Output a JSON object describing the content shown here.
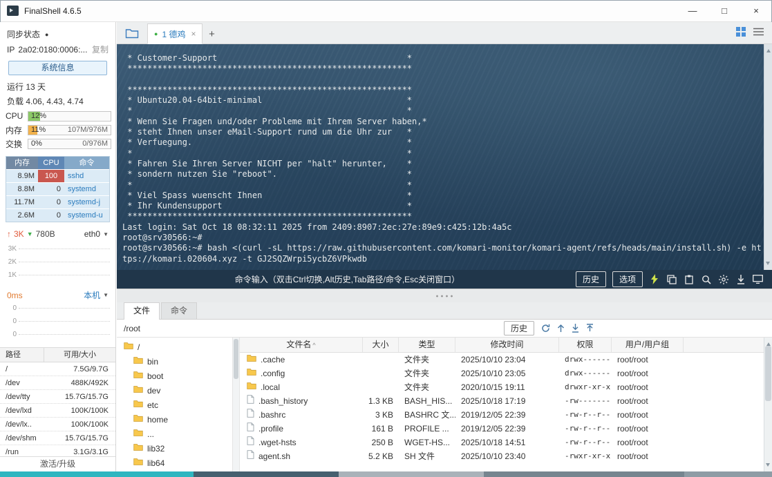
{
  "window": {
    "title": "FinalShell 4.6.5",
    "minimize": "—",
    "maximize": "□",
    "close": "×"
  },
  "sidebar": {
    "sync_label": "同步状态",
    "sync_dot": "●",
    "ip_label": "IP",
    "ip_value": "2a02:0180:0006:...",
    "copy_link": "复制",
    "sysinfo_button": "系统信息",
    "uptime": "运行 13 天",
    "load": "负载 4.06, 4.43, 4.74",
    "meters": {
      "cpu_label": "CPU",
      "cpu_percent": "12%",
      "mem_label": "内存",
      "mem_percent": "11%",
      "mem_detail": "107M/976M",
      "swap_label": "交换",
      "swap_percent": "0%",
      "swap_detail": "0/976M"
    },
    "process_table": {
      "col_mem": "内存",
      "col_cpu": "CPU",
      "col_cmd": "命令",
      "rows": [
        {
          "mem": "8.9M",
          "cpu": "100",
          "cmd": "sshd"
        },
        {
          "mem": "8.8M",
          "cpu": "0",
          "cmd": "systemd"
        },
        {
          "mem": "11.7M",
          "cpu": "0",
          "cmd": "systemd-j"
        },
        {
          "mem": "2.6M",
          "cpu": "0",
          "cmd": "systemd-u"
        }
      ]
    },
    "network": {
      "up_arrow": "↑",
      "up_value": "3K",
      "down_arrow": "▼",
      "down_value": "780B",
      "interface": "eth0",
      "caret": "▼",
      "y_labels": [
        "3K",
        "2K",
        "1K"
      ]
    },
    "ping": {
      "latency": "0ms",
      "target": "本机",
      "caret": "▼",
      "y_labels": [
        "0",
        "0",
        "0"
      ]
    },
    "disk_table": {
      "col_path": "路径",
      "col_size": "可用/大小",
      "rows": [
        {
          "path": "/",
          "size": "7.5G/9.7G"
        },
        {
          "path": "/dev",
          "size": "488K/492K"
        },
        {
          "path": "/dev/tty",
          "size": "15.7G/15.7G"
        },
        {
          "path": "/dev/lxd",
          "size": "100K/100K"
        },
        {
          "path": "/dev/lx..",
          "size": "100K/100K"
        },
        {
          "path": "/dev/shm",
          "size": "15.7G/15.7G"
        },
        {
          "path": "/run",
          "size": "3.1G/3.1G"
        }
      ]
    },
    "activate_label": "激活/升级"
  },
  "tabbar": {
    "session_tab": {
      "dot": "●",
      "label": "1 德鸡",
      "close": "×"
    },
    "new_tab": "+"
  },
  "terminal": {
    "lines": [
      " * Customer-Support                                      *",
      " *********************************************************",
      "",
      " *********************************************************",
      " * Ubuntu20.04-64bit-minimal                             *",
      " *                                                       *",
      " * Wenn Sie Fragen und/oder Probleme mit Ihrem Server haben,*",
      " * steht Ihnen unser eMail-Support rund um die Uhr zur   *",
      " * Verfuegung.                                           *",
      " *                                                       *",
      " * Fahren Sie Ihren Server NICHT per \"halt\" herunter,    *",
      " * sondern nutzen Sie \"reboot\".                          *",
      " *                                                       *",
      " * Viel Spass wuenscht Ihnen                             *",
      " * Ihr Kundensupport                                     *",
      " *********************************************************",
      "Last login: Sat Oct 18 08:32:11 2025 from 2409:8907:2ec:27e:89e9:c425:12b:4a5c",
      "root@srv30566:~# ",
      "root@srv30566:~# bash <(curl -sL https://raw.githubusercontent.com/komari-monitor/komari-agent/refs/heads/main/install.sh) -e ht",
      "tps://komari.020604.xyz -t GJ2SQZWrpi5ycbZ6VPkwdb"
    ]
  },
  "cmdbar": {
    "hint": "命令输入（双击Ctrl切换,Alt历史,Tab路径/命令,Esc关闭窗口）",
    "history_button": "历史",
    "options_button": "选项"
  },
  "filepanel": {
    "tab_files": "文件",
    "tab_commands": "命令",
    "path": "/root",
    "history_button": "历史",
    "tree": {
      "root": "/",
      "items": [
        "bin",
        "boot",
        "dev",
        "etc",
        "home",
        "...",
        "lib32",
        "lib64"
      ]
    },
    "table": {
      "col_name": "文件名",
      "sort_caret": "^",
      "col_size": "大小",
      "col_type": "类型",
      "col_mtime": "修改时间",
      "col_perm": "权限",
      "col_owner": "用户/用户组",
      "rows": [
        {
          "icon": "folder-icon",
          "name": ".cache",
          "size": "",
          "type": "文件夹",
          "mtime": "2025/10/10 23:04",
          "perm": "drwx------",
          "owner": "root/root"
        },
        {
          "icon": "folder-icon",
          "name": ".config",
          "size": "",
          "type": "文件夹",
          "mtime": "2025/10/10 23:05",
          "perm": "drwx------",
          "owner": "root/root"
        },
        {
          "icon": "folder-icon",
          "name": ".local",
          "size": "",
          "type": "文件夹",
          "mtime": "2020/10/15 19:11",
          "perm": "drwxr-xr-x",
          "owner": "root/root"
        },
        {
          "icon": "file-icon",
          "name": ".bash_history",
          "size": "1.3 KB",
          "type": "BASH_HIS...",
          "mtime": "2025/10/18 17:19",
          "perm": "-rw-------",
          "owner": "root/root"
        },
        {
          "icon": "file-icon",
          "name": ".bashrc",
          "size": "3 KB",
          "type": "BASHRC 文...",
          "mtime": "2019/12/05 22:39",
          "perm": "-rw-r--r--",
          "owner": "root/root"
        },
        {
          "icon": "file-icon",
          "name": ".profile",
          "size": "161 B",
          "type": "PROFILE ...",
          "mtime": "2019/12/05 22:39",
          "perm": "-rw-r--r--",
          "owner": "root/root"
        },
        {
          "icon": "file-icon",
          "name": ".wget-hsts",
          "size": "250 B",
          "type": "WGET-HS...",
          "mtime": "2025/10/18 14:51",
          "perm": "-rw-r--r--",
          "owner": "root/root"
        },
        {
          "icon": "file-icon",
          "name": "agent.sh",
          "size": "5.2 KB",
          "type": "SH 文件",
          "mtime": "2025/10/10 23:40",
          "perm": "-rwxr-xr-x",
          "owner": "root/root"
        }
      ]
    }
  },
  "colors": {
    "accent_blue": "#2a7bbd",
    "cpu_fill": "#8cc868",
    "mem_fill": "#f2b24c",
    "cpu_alert": "#c9574f",
    "terminal_bg": "#2e4c66",
    "taskbar_teal": "#2eb6c0"
  }
}
